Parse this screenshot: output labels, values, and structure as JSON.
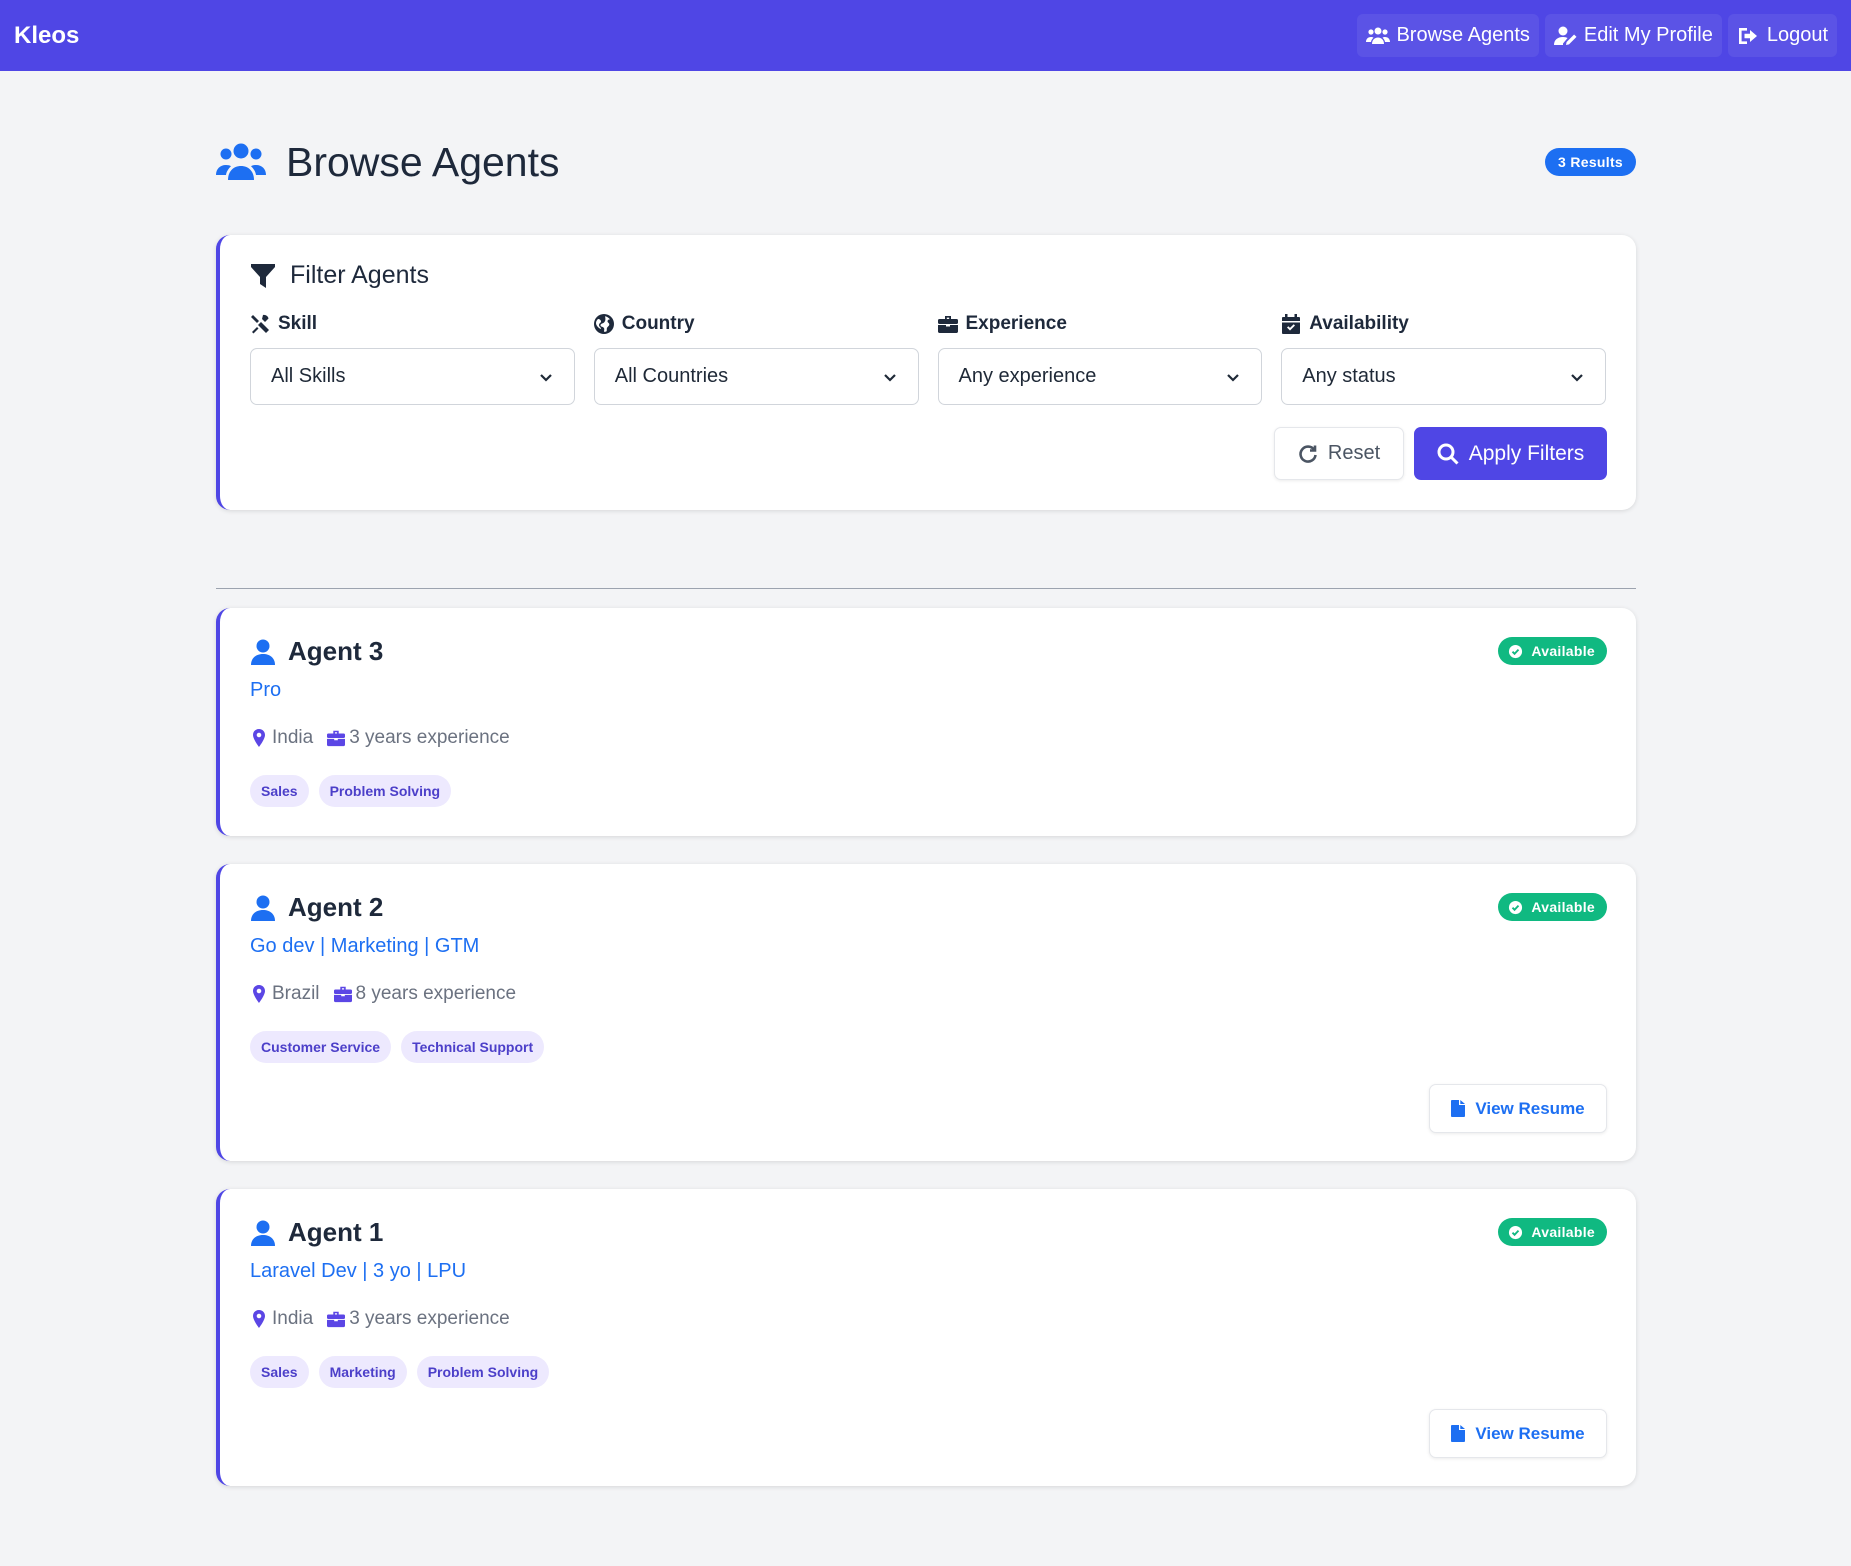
{
  "navbar": {
    "brand": "Kleos",
    "links": [
      {
        "label": "Browse Agents",
        "icon": "users-icon"
      },
      {
        "label": "Edit My Profile",
        "icon": "user-edit-icon"
      },
      {
        "label": "Logout",
        "icon": "logout-icon"
      }
    ]
  },
  "page": {
    "title": "Browse Agents",
    "results_badge": "3 Results"
  },
  "filters": {
    "title": "Filter Agents",
    "fields": [
      {
        "label": "Skill",
        "icon": "tools-icon",
        "value": "All Skills"
      },
      {
        "label": "Country",
        "icon": "globe-icon",
        "value": "All Countries"
      },
      {
        "label": "Experience",
        "icon": "briefcase-icon",
        "value": "Any experience"
      },
      {
        "label": "Availability",
        "icon": "calendar-check-icon",
        "value": "Any status"
      }
    ],
    "reset_label": "Reset",
    "apply_label": "Apply Filters"
  },
  "agents": [
    {
      "name": "Agent 3",
      "headline": "Pro",
      "country": "India",
      "experience": "3 years experience",
      "status": "Available",
      "skills": [
        "Sales",
        "Problem Solving"
      ],
      "resume_label": ""
    },
    {
      "name": "Agent 2",
      "headline": "Go dev | Marketing | GTM",
      "country": "Brazil",
      "experience": "8 years experience",
      "status": "Available",
      "skills": [
        "Customer Service",
        "Technical Support"
      ],
      "resume_label": "View Resume"
    },
    {
      "name": "Agent 1",
      "headline": "Laravel Dev | 3 yo | LPU",
      "country": "India",
      "experience": "3 years experience",
      "status": "Available",
      "skills": [
        "Sales",
        "Marketing",
        "Problem Solving"
      ],
      "resume_label": "View Resume"
    }
  ],
  "colors": {
    "primary": "#4f46e5",
    "link": "#1d6ff2",
    "success": "#10b981",
    "chip_bg": "#ede9fe",
    "background": "#f3f4f6"
  }
}
